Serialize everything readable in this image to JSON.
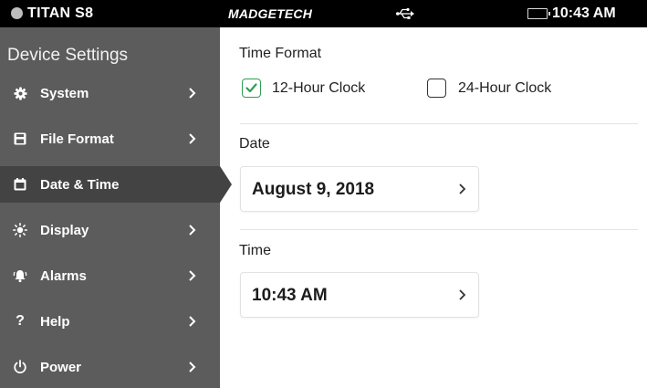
{
  "status_bar": {
    "device_name": "TITAN S8",
    "brand": "MADGETECH",
    "usb_icon": "usb-icon",
    "battery_icon": "battery-icon",
    "time": "10:43 AM",
    "colors": {
      "background": "#000000",
      "battery": "#2db84b"
    }
  },
  "sidebar": {
    "title": "Device Settings",
    "items": [
      {
        "label": "System",
        "icon": "gear-icon",
        "active": false
      },
      {
        "label": "File Format",
        "icon": "save-icon",
        "active": false
      },
      {
        "label": "Date & Time",
        "icon": "calendar-icon",
        "active": true
      },
      {
        "label": "Display",
        "icon": "brightness-icon",
        "active": false
      },
      {
        "label": "Alarms",
        "icon": "bell-icon",
        "active": false
      },
      {
        "label": "Help",
        "icon": "help-icon",
        "glyph": "?",
        "active": false
      },
      {
        "label": "Power",
        "icon": "power-icon",
        "active": false
      }
    ],
    "colors": {
      "background": "#5c5c5c",
      "active": "#434343"
    }
  },
  "main": {
    "time_format": {
      "title": "Time Format",
      "options": [
        {
          "label": "12-Hour Clock",
          "checked": true
        },
        {
          "label": "24-Hour Clock",
          "checked": false
        }
      ],
      "check_color": "#2e9e52"
    },
    "date": {
      "title": "Date",
      "value": "August 9, 2018"
    },
    "time": {
      "title": "Time",
      "value": "10:43 AM"
    }
  }
}
